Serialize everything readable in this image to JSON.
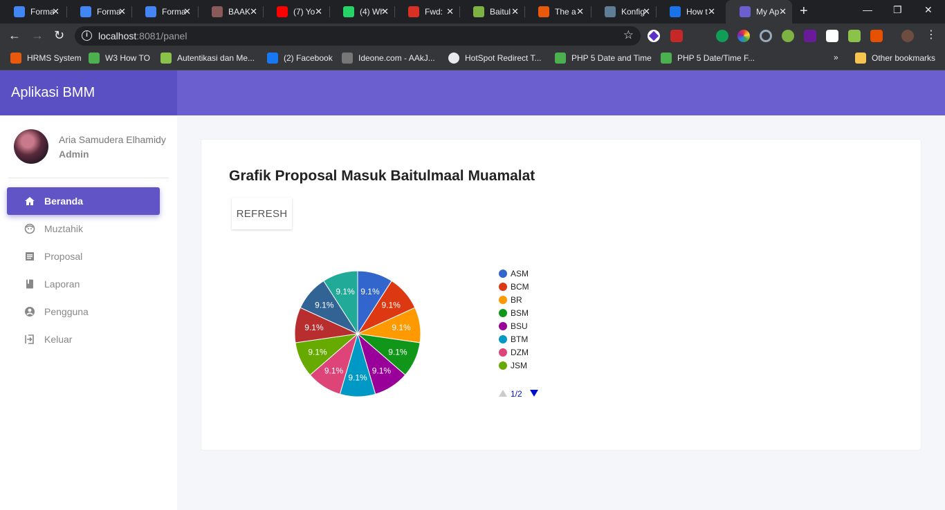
{
  "browser": {
    "tabs": [
      {
        "title": "Forma",
        "favicon": "docs-icon",
        "color": "#4285f4"
      },
      {
        "title": "Forma",
        "favicon": "docs-icon",
        "color": "#4285f4"
      },
      {
        "title": "Forma",
        "favicon": "docs-icon",
        "color": "#4285f4"
      },
      {
        "title": "BAAK",
        "favicon": "seal-icon",
        "color": "#8a5a5a"
      },
      {
        "title": "(7) Yo",
        "favicon": "youtube-icon",
        "color": "#ff0000"
      },
      {
        "title": "(4) Wh",
        "favicon": "whatsapp-icon",
        "color": "#25d366"
      },
      {
        "title": "Fwd: ",
        "favicon": "gmail-icon",
        "color": "#d93025"
      },
      {
        "title": "Baitul",
        "favicon": "baitul-icon",
        "color": "#7cb342"
      },
      {
        "title": "The a",
        "favicon": "ask-icon",
        "color": "#e8590c"
      },
      {
        "title": "Konfig",
        "favicon": "page-icon",
        "color": "#5f7d95"
      },
      {
        "title": "How t",
        "favicon": "how-icon",
        "color": "#1a73e8"
      },
      {
        "title": "My Ap",
        "favicon": "app-icon",
        "color": "#6b5ecf",
        "active": true
      }
    ],
    "url_host": "localhost",
    "url_rest": ":8081/panel",
    "bookmarks": [
      {
        "label": "HRMS System",
        "icon": "hrms-icon",
        "color": "#e8590c"
      },
      {
        "label": "W3 How TO",
        "icon": "w3-icon",
        "color": "#4caf50"
      },
      {
        "label": "Autentikasi dan Me...",
        "icon": "code-icon",
        "color": "#8bc34a"
      },
      {
        "label": "(2) Facebook",
        "icon": "facebook-icon",
        "color": "#1877f2"
      },
      {
        "label": "Ideone.com - AAkJ...",
        "icon": "ideone-icon",
        "color": "#777777"
      },
      {
        "label": "HotSpot Redirect T...",
        "icon": "globe-icon",
        "color": "#e8eaed"
      },
      {
        "label": "PHP 5 Date and Time",
        "icon": "w3-icon",
        "color": "#4caf50"
      },
      {
        "label": "PHP 5 Date/Time F...",
        "icon": "w3-icon",
        "color": "#4caf50"
      }
    ],
    "other_bookmarks": "Other bookmarks",
    "more_bookmarks": "»"
  },
  "app": {
    "brand": "Aplikasi BMM",
    "user": {
      "name": "Aria Samudera Elhamidy",
      "role": "Admin"
    },
    "menu": [
      {
        "label": "Beranda",
        "icon": "home-icon",
        "active": true
      },
      {
        "label": "Muztahik",
        "icon": "face-icon"
      },
      {
        "label": "Proposal",
        "icon": "list-icon"
      },
      {
        "label": "Laporan",
        "icon": "book-icon"
      },
      {
        "label": "Pengguna",
        "icon": "account-icon"
      },
      {
        "label": "Keluar",
        "icon": "logout-icon"
      }
    ],
    "card_title": "Grafik Proposal Masuk Baitulmaal Muamalat",
    "refresh_label": "REFRESH",
    "accent": "#6b5ecf"
  },
  "chart_data": {
    "type": "pie",
    "slice_label": "9.1%",
    "series": [
      {
        "name": "ASM",
        "value": 1,
        "color": "#3366cc"
      },
      {
        "name": "BCM",
        "value": 1,
        "color": "#dc3912"
      },
      {
        "name": "BR",
        "value": 1,
        "color": "#ff9900"
      },
      {
        "name": "BSM",
        "value": 1,
        "color": "#109618"
      },
      {
        "name": "BSU",
        "value": 1,
        "color": "#990099"
      },
      {
        "name": "BTM",
        "value": 1,
        "color": "#0099c6"
      },
      {
        "name": "DZM",
        "value": 1,
        "color": "#dd4477"
      },
      {
        "name": "JSM",
        "value": 1,
        "color": "#66aa00"
      },
      {
        "value": 1,
        "color": "#b82e2e"
      },
      {
        "value": 1,
        "color": "#316395"
      },
      {
        "value": 1,
        "color": "#22aa99"
      }
    ],
    "legend_visible": 8,
    "legend_page": "1/2",
    "legend_position": "right"
  }
}
